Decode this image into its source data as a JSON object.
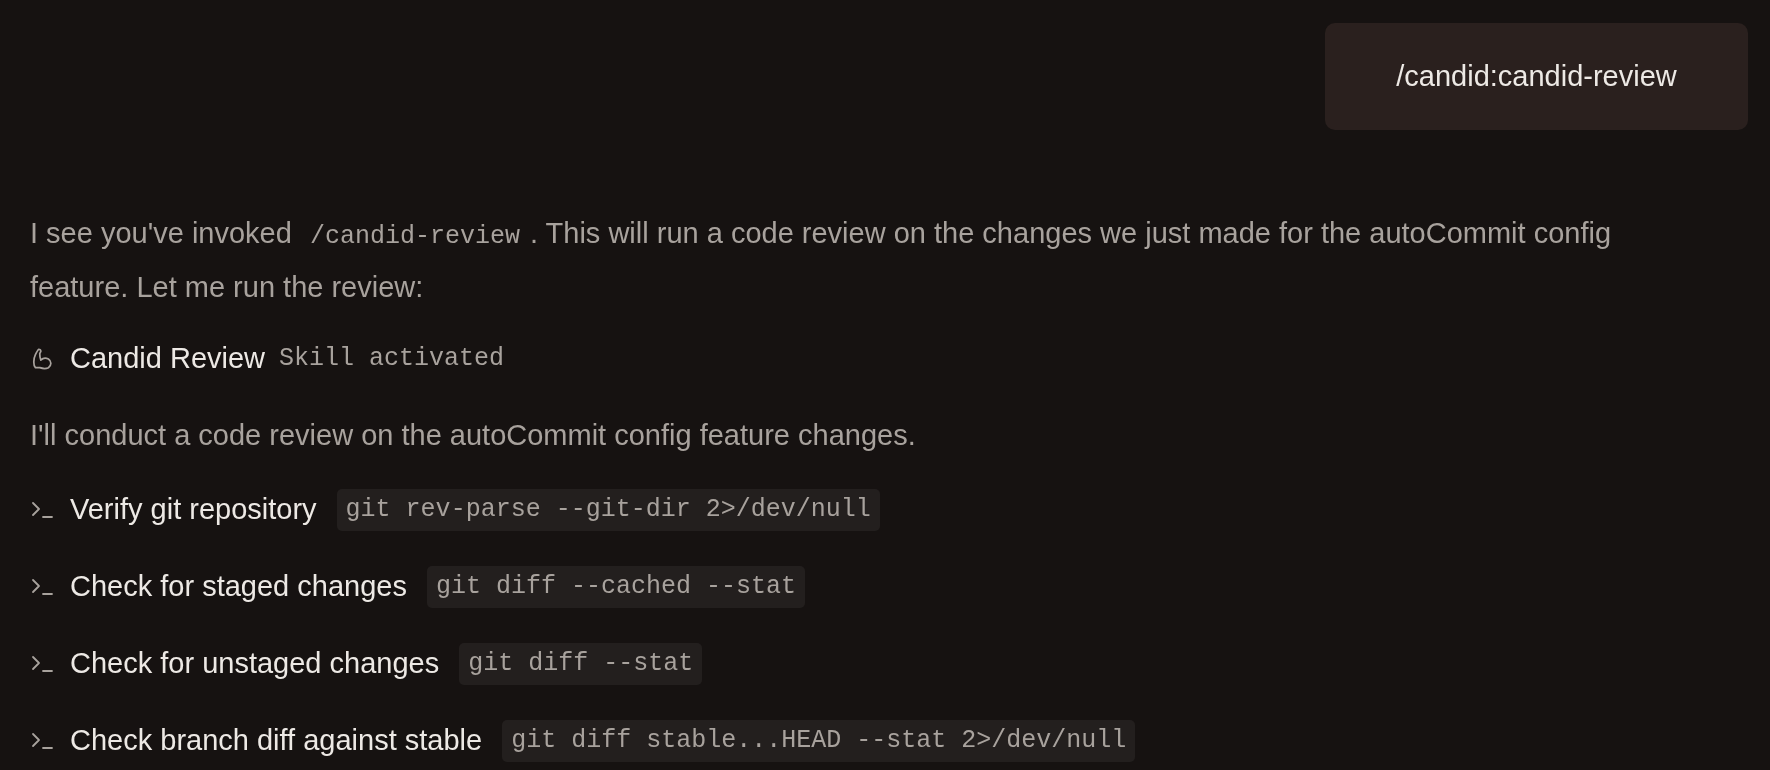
{
  "user_message": {
    "text": "/candid:candid-review"
  },
  "reply": {
    "paragraph": [
      {
        "kind": "text",
        "text": "I see you've invoked "
      },
      {
        "kind": "code",
        "text": "/candid-review"
      },
      {
        "kind": "text",
        "text": ". This will run a code review on the changes we just made for the autoCommit config feature. Let me run the review:"
      }
    ],
    "skill": {
      "name": "Candid Review",
      "status": "Skill activated"
    },
    "intro": "I'll conduct a code review on the autoCommit config feature changes.",
    "steps": [
      {
        "label": "Verify git repository",
        "command": "git rev-parse --git-dir 2>/dev/null"
      },
      {
        "label": "Check for staged changes",
        "command": "git diff --cached --stat"
      },
      {
        "label": "Check for unstaged changes",
        "command": "git diff --stat"
      },
      {
        "label": "Check branch diff against stable",
        "command": "git diff stable...HEAD --stat 2>/dev/null"
      }
    ]
  }
}
